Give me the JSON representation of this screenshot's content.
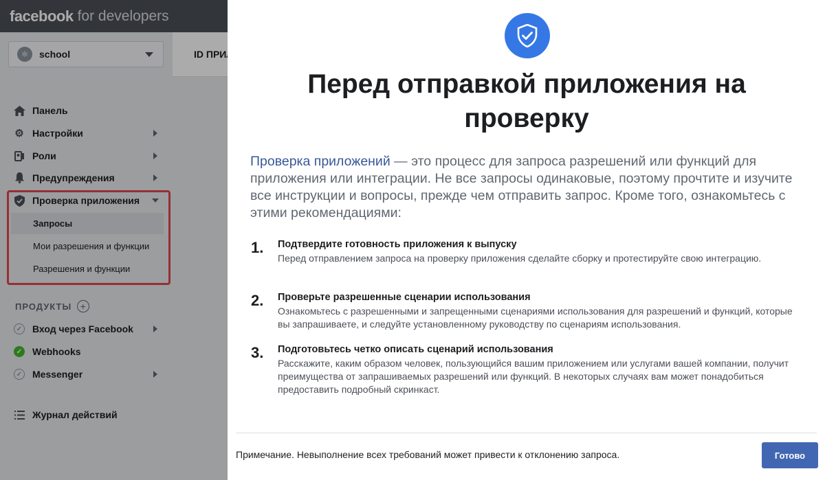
{
  "topbar": {
    "brand": "facebook",
    "brand_suffix": "for developers"
  },
  "app_selector": {
    "name": "school"
  },
  "content": {
    "header_text": "ID ПРИЛОЖЕНИЯ"
  },
  "sidebar": {
    "items": [
      {
        "label": "Панель",
        "icon": "home-icon"
      },
      {
        "label": "Настройки",
        "icon": "gear-icon"
      },
      {
        "label": "Роли",
        "icon": "roles-icon"
      },
      {
        "label": "Предупреждения",
        "icon": "bell-icon"
      },
      {
        "label": "Проверка приложения",
        "icon": "shield-icon"
      }
    ],
    "review_sub": [
      "Запросы",
      "Мои разрешения и функции",
      "Разрешения и функции"
    ],
    "products_heading": "ПРОДУКТЫ",
    "products": [
      {
        "label": "Вход через Facebook",
        "status": "inactive"
      },
      {
        "label": "Webhooks",
        "status": "active"
      },
      {
        "label": "Messenger",
        "status": "inactive"
      }
    ],
    "activity_log": "Журнал действий"
  },
  "modal": {
    "title": "Перед отправкой приложения на проверку",
    "intro_link": "Проверка приложений",
    "intro_text": " — это процесс для запроса разрешений или функций для приложения или интеграции. Не все запросы одинаковые, поэтому прочтите и изучите все инструкции и вопросы, прежде чем отправить запрос. Кроме того, ознакомьтесь с этими рекомендациями:",
    "steps": [
      {
        "num": "1.",
        "title": "Подтвердите готовность приложения к выпуску",
        "desc": "Перед отправлением запроса на проверку приложения сделайте сборку и протестируйте свою интеграцию."
      },
      {
        "num": "2.",
        "title": "Проверьте разрешенные сценарии использования",
        "desc": "Ознакомьтесь с разрешенными и запрещенными сценариями использования для разрешений и функций, которые вы запрашиваете, и следуйте установленному руководству по сценариям использования."
      },
      {
        "num": "3.",
        "title": "Подготовьтесь четко описать сценарий использования",
        "desc": "Расскажите, каким образом человек, пользующийся вашим приложением или услугами вашей компании, получит преимущества от запрашиваемых разрешений или функций. В некоторых случаях вам может понадобиться предоставить подробный скринкаст."
      }
    ],
    "footer_note": "Примечание. Невыполнение всех требований может привести к отклонению запроса.",
    "done_label": "Готово"
  },
  "colors": {
    "accent": "#4267b2",
    "badge": "#3578e5",
    "highlight_border": "#e0474c",
    "active_check": "#42b72a"
  }
}
